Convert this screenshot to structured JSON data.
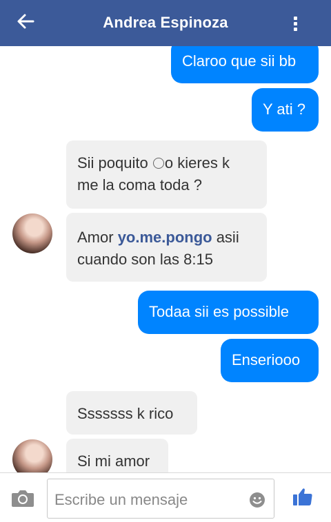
{
  "header": {
    "title": "Andrea Espinoza"
  },
  "messages": [
    {
      "direction": "out",
      "text": "Claroo que sii bb"
    },
    {
      "direction": "out",
      "text": "Y ati ?"
    },
    {
      "direction": "in",
      "text_before": "Sii poquito ",
      "text_after": "o kieres k",
      "text_line2": "me la coma toda ?"
    },
    {
      "direction": "in",
      "text_before": "Amor ",
      "link": "yo.me.pongo",
      "text_after": " asii",
      "text_line2": "cuando son las 8:15"
    },
    {
      "direction": "out",
      "text": "Todaa sii es possible"
    },
    {
      "direction": "out",
      "text": "Enseriooo"
    },
    {
      "direction": "in",
      "text": "Sssssss k rico"
    },
    {
      "direction": "in",
      "text": "Si mi amor"
    }
  ],
  "composer": {
    "placeholder": "Escribe un mensaje"
  },
  "colors": {
    "header": "#3c5a99",
    "outgoing_bubble": "#0084ff",
    "incoming_bubble": "#f0f0f0",
    "link": "#3b5998"
  },
  "icons": {
    "back": "back-arrow-icon",
    "menu": "more-vertical-icon",
    "camera": "camera-icon",
    "emoji": "emoji-icon",
    "like": "thumbs-up-icon"
  }
}
